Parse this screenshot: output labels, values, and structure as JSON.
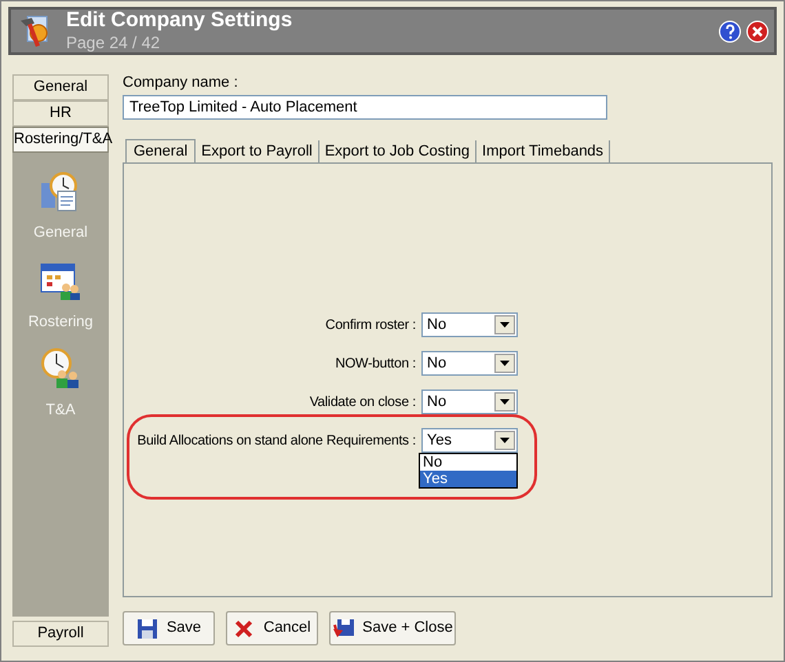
{
  "window": {
    "title": "Edit Company Settings",
    "subtitle": "Page 24 / 42"
  },
  "sidebar": {
    "sections": [
      {
        "label": "General",
        "selected": false
      },
      {
        "label": "HR",
        "selected": false
      },
      {
        "label": "Rostering/T&A",
        "selected": true
      }
    ],
    "items": [
      {
        "label": "General",
        "kind": "clock-doc"
      },
      {
        "label": "Rostering",
        "kind": "calendar"
      },
      {
        "label": "T&A",
        "kind": "clock-people"
      }
    ],
    "bottom_sections": [
      {
        "label": "Payroll",
        "selected": false
      }
    ]
  },
  "company_name": {
    "label": "Company name :",
    "value": "TreeTop Limited - Auto Placement"
  },
  "tabs": [
    {
      "label": "General",
      "selected": true
    },
    {
      "label": "Export to Payroll",
      "selected": false
    },
    {
      "label": "Export to Job Costing",
      "selected": false
    },
    {
      "label": "Import Timebands",
      "selected": false
    }
  ],
  "fields": [
    {
      "label": "Confirm roster :",
      "value": "No",
      "highlighted": false
    },
    {
      "label": "NOW-button :",
      "value": "No",
      "highlighted": false
    },
    {
      "label": "Validate on close :",
      "value": "No",
      "highlighted": false
    },
    {
      "label": "Build Allocations on stand alone Requirements :",
      "value": "Yes",
      "highlighted": true,
      "expanded": true,
      "options": [
        {
          "label": "No",
          "selected": false
        },
        {
          "label": "Yes",
          "selected": true
        }
      ]
    }
  ],
  "buttons": [
    {
      "label": "Save",
      "kind": "save"
    },
    {
      "label": "Cancel",
      "kind": "cancel"
    },
    {
      "label": "Save + Close",
      "kind": "save-close"
    }
  ]
}
